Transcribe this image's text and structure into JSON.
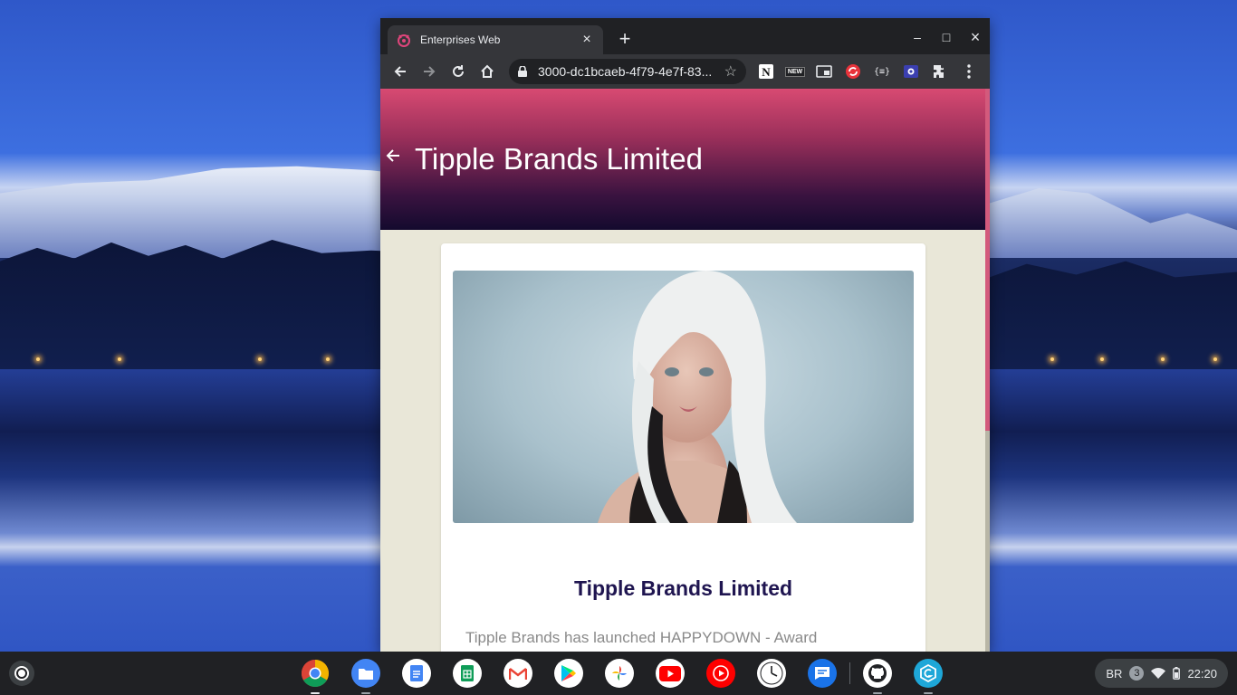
{
  "browser": {
    "tab_title": "Enterprises Web",
    "tab_close": "×",
    "new_tab": "+",
    "url": "3000-dc1bcaeb-4f79-4e7f-83...",
    "ext_new_label": "NEW",
    "ext_json_label": "{≡}",
    "minimize": "–",
    "maximize": "□",
    "close": "×"
  },
  "page": {
    "header_title": "Tipple Brands Limited",
    "card_title": "Tipple Brands Limited",
    "card_text": "Tipple Brands has launched HAPPYDOWN - Award"
  },
  "shelf": {
    "apps": [
      "chrome",
      "files",
      "docs",
      "sheets",
      "gmail",
      "play-store",
      "photos",
      "youtube",
      "youtube-music",
      "clock",
      "messages",
      "github",
      "gcp"
    ],
    "tray_lang": "BR",
    "tray_notifications": "3",
    "tray_time": "22:20"
  }
}
